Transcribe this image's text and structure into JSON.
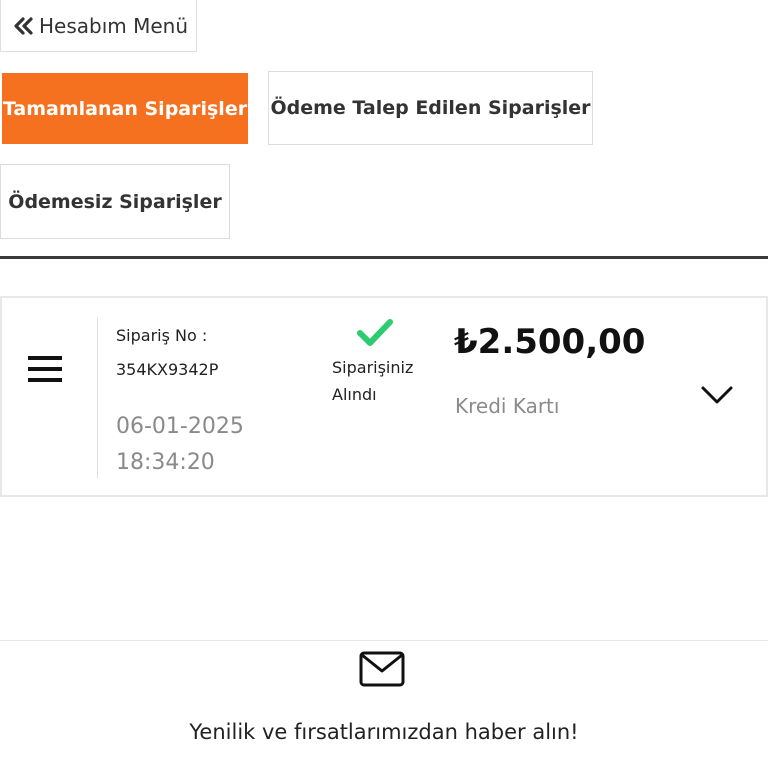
{
  "header": {
    "back_label": "Hesabım Menü",
    "back_icon": "double-chevron-left-icon"
  },
  "tabs": [
    {
      "label": "Tamamlanan Siparişler",
      "active": true
    },
    {
      "label": "Ödeme Talep Edilen Siparişler",
      "active": false
    },
    {
      "label": "Ödemesiz Siparişler",
      "active": false
    }
  ],
  "order": {
    "order_no_label": "Sipariş No :",
    "order_no": "354KX9342P",
    "date": "06-01-2025",
    "time": "18:34:20",
    "status_line1": "Siparişiniz",
    "status_line2": "Alındı",
    "status_icon": "check-icon",
    "amount": "₺2.500,00",
    "payment_method": "Kredi Kartı",
    "menu_icon": "hamburger-menu-icon",
    "expand_icon": "chevron-down-icon"
  },
  "footer": {
    "mail_icon": "envelope-icon",
    "newsletter_text": "Yenilik ve fırsatlarımızdan haber alın!"
  },
  "colors": {
    "accent": "#f5701f",
    "success": "#2ecc71",
    "muted_text": "#8a8a8a"
  }
}
